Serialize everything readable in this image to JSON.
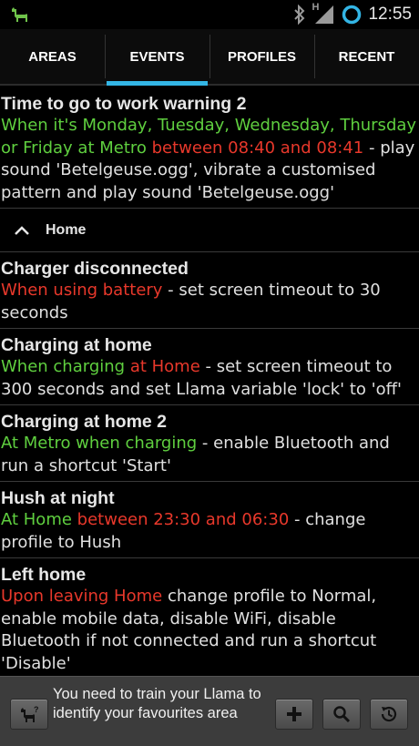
{
  "status_bar": {
    "time": "12:55",
    "network_label": "H",
    "icons": [
      "llama-icon",
      "bluetooth-icon",
      "signal-icon",
      "sync-ring-icon"
    ]
  },
  "tabs": [
    {
      "label": "AREAS",
      "active": false
    },
    {
      "label": "EVENTS",
      "active": true
    },
    {
      "label": "PROFILES",
      "active": false
    },
    {
      "label": "RECENT",
      "active": false
    }
  ],
  "colors": {
    "accent": "#33b5e5",
    "condition_green": "#5fcf3f",
    "condition_red": "#e8382b"
  },
  "events": {
    "e0": {
      "title": "Time to go to work warning 2",
      "parts": [
        "When it's Monday, Tuesday, Wednesday, Thursday or Friday at Metro",
        " between 08:40 and 08:41",
        " - play sound 'Betelgeuse.ogg', vibrate a customised pattern and play sound 'Betelgeuse.ogg'"
      ]
    },
    "group_home": {
      "label": "Home",
      "icon": "chevron-up-icon"
    },
    "e1": {
      "title": "Charger disconnected",
      "parts": [
        "When using battery",
        " - set screen timeout to 30 seconds"
      ]
    },
    "e2": {
      "title": "Charging at home",
      "parts": [
        "When charging",
        " at Home",
        " - set screen timeout to 300 seconds and set Llama variable 'lock' to 'off'"
      ]
    },
    "e3": {
      "title": "Charging at home 2",
      "parts": [
        "At Metro when charging",
        " - enable Bluetooth and run a shortcut 'Start'"
      ]
    },
    "e4": {
      "title": "Hush at night",
      "parts": [
        "At Home",
        " between 23:30 and 06:30",
        " - change profile to Hush"
      ]
    },
    "e5": {
      "title": "Left home",
      "parts": [
        "Upon leaving Home",
        " change profile to Normal, enable mobile data, disable WiFi, disable Bluetooth if not connected and run a shortcut 'Disable'"
      ]
    }
  },
  "bottom_bar": {
    "message": "You need to train your Llama to identify your favourites area",
    "buttons": [
      "llama-train-icon",
      "add-icon",
      "search-icon",
      "history-icon"
    ]
  }
}
